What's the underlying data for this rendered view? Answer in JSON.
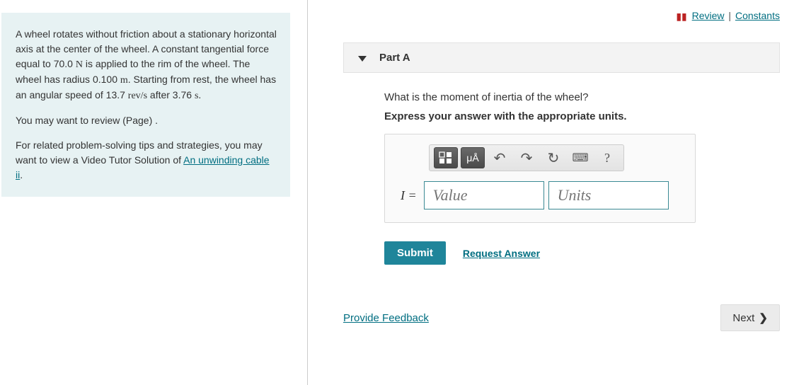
{
  "problem": {
    "para1_a": "A wheel rotates without friction about a stationary horizontal axis at the center of the wheel. A constant tangential force equal to 70.0 ",
    "para1_N": "N",
    "para1_b": " is applied to the rim of the wheel. The wheel has radius 0.100 ",
    "para1_m": "m",
    "para1_c": ". Starting from rest, the wheel has an angular speed of 13.7 ",
    "para1_revs": "rev/s",
    "para1_d": " after 3.76 ",
    "para1_s": "s",
    "para1_e": ".",
    "para2": "You may want to review (Page) .",
    "para3_a": "For related problem-solving tips and strategies, you may want to view a Video Tutor Solution of ",
    "para3_link": "An unwinding cable ii",
    "para3_b": "."
  },
  "topLinks": {
    "review": "Review",
    "constants": "Constants"
  },
  "part": {
    "title": "Part A",
    "question": "What is the moment of inertia of the wheel?",
    "instruction": "Express your answer with the appropriate units.",
    "varLabel": "I =",
    "valuePlaceholder": "Value",
    "unitsPlaceholder": "Units"
  },
  "toolbar": {
    "templates": "▥",
    "greek": "μÅ",
    "undo": "↶",
    "redo": "↷",
    "reset": "↻",
    "keyboard": "⌨",
    "help": "?"
  },
  "actions": {
    "submit": "Submit",
    "requestAnswer": "Request Answer",
    "provideFeedback": "Provide Feedback",
    "next": "Next"
  }
}
